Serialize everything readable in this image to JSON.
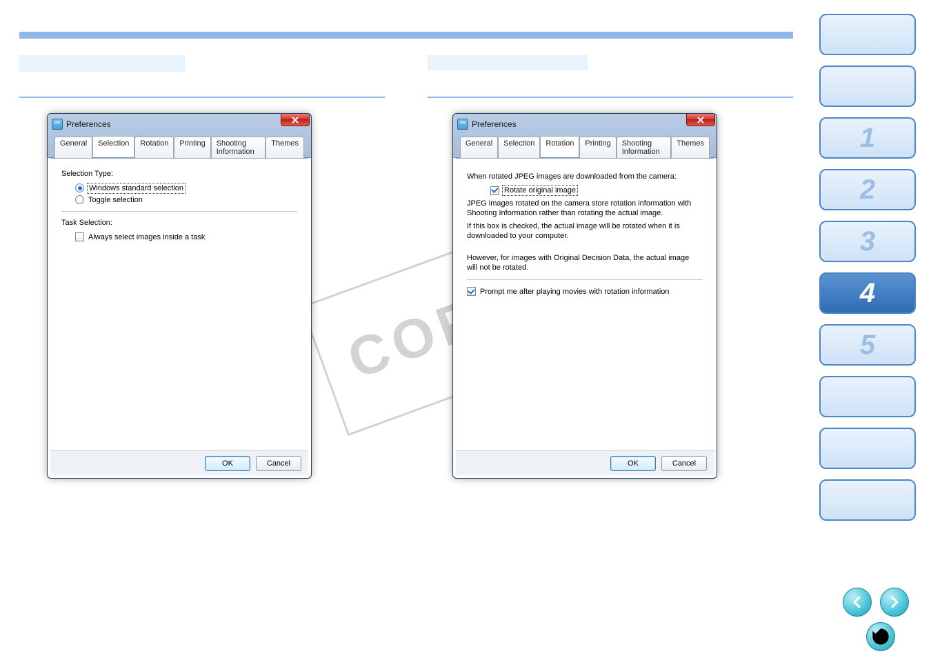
{
  "watermark": "COPY",
  "tabs": {
    "general": "General",
    "selection": "Selection",
    "rotation": "Rotation",
    "printing": "Printing",
    "shooting": "Shooting Information",
    "themes": "Themes"
  },
  "buttons": {
    "ok": "OK",
    "cancel": "Cancel"
  },
  "dialog_left": {
    "title": "Preferences",
    "active_tab": "selection",
    "selection_type_label": "Selection Type:",
    "opt_windows_standard": "Windows standard selection",
    "opt_toggle": "Toggle selection",
    "task_selection_label": "Task Selection:",
    "chk_always_select": "Always select images inside a task"
  },
  "dialog_right": {
    "title": "Preferences",
    "active_tab": "rotation",
    "heading": "When rotated JPEG images are downloaded from the camera:",
    "chk_rotate_original": "Rotate original image",
    "para1": "JPEG images rotated on the camera store rotation information with Shooting Information rather than rotating the actual image.",
    "para2": "If this box is checked, the actual image will be rotated when it is downloaded to your computer.",
    "para3": "However, for images with Original Decision Data, the actual image will not be rotated.",
    "chk_prompt_movies": "Prompt me after playing movies with rotation information"
  },
  "sidebar": {
    "items": [
      "",
      "",
      "1",
      "2",
      "3",
      "4",
      "5",
      "",
      "",
      ""
    ],
    "active_index": 5
  }
}
